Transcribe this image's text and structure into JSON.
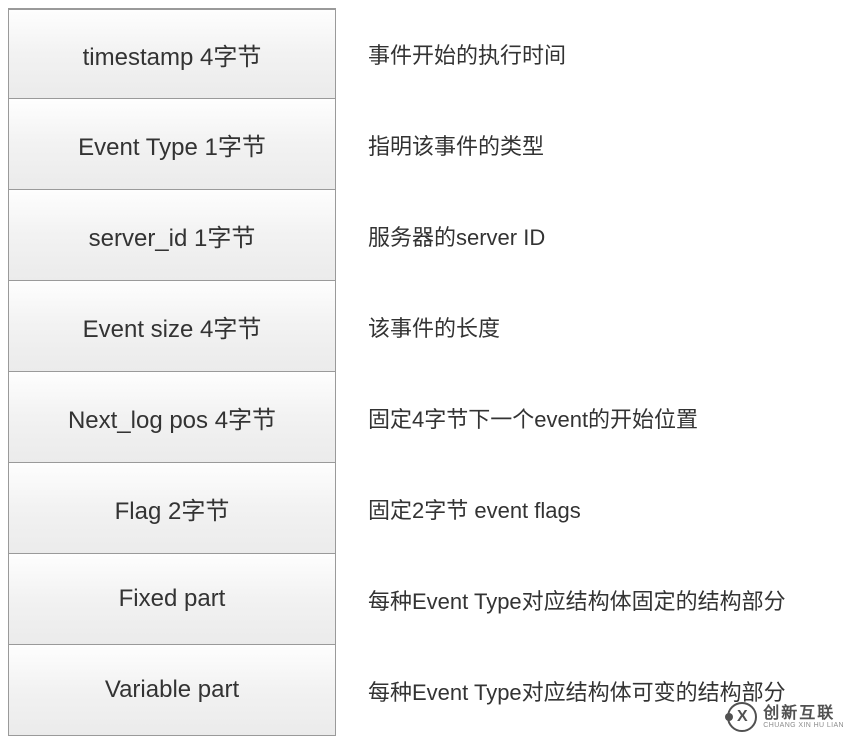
{
  "rows": [
    {
      "label": "timestamp 4字节",
      "desc": "事件开始的执行时间"
    },
    {
      "label": "Event Type 1字节",
      "desc": "指明该事件的类型"
    },
    {
      "label": "server_id 1字节",
      "desc": "服务器的server ID"
    },
    {
      "label": "Event size  4字节",
      "desc": "该事件的长度"
    },
    {
      "label": "Next_log pos 4字节",
      "desc": "固定4字节下一个event的开始位置"
    },
    {
      "label": "Flag 2字节",
      "desc": "固定2字节 event flags"
    },
    {
      "label": "Fixed part",
      "desc": "每种Event Type对应结构体固定的结构部分"
    },
    {
      "label": "Variable part",
      "desc": "每种Event Type对应结构体可变的结构部分"
    }
  ],
  "watermark": {
    "cn": "创新互联",
    "en": "CHUANG XIN HU LIAN"
  }
}
